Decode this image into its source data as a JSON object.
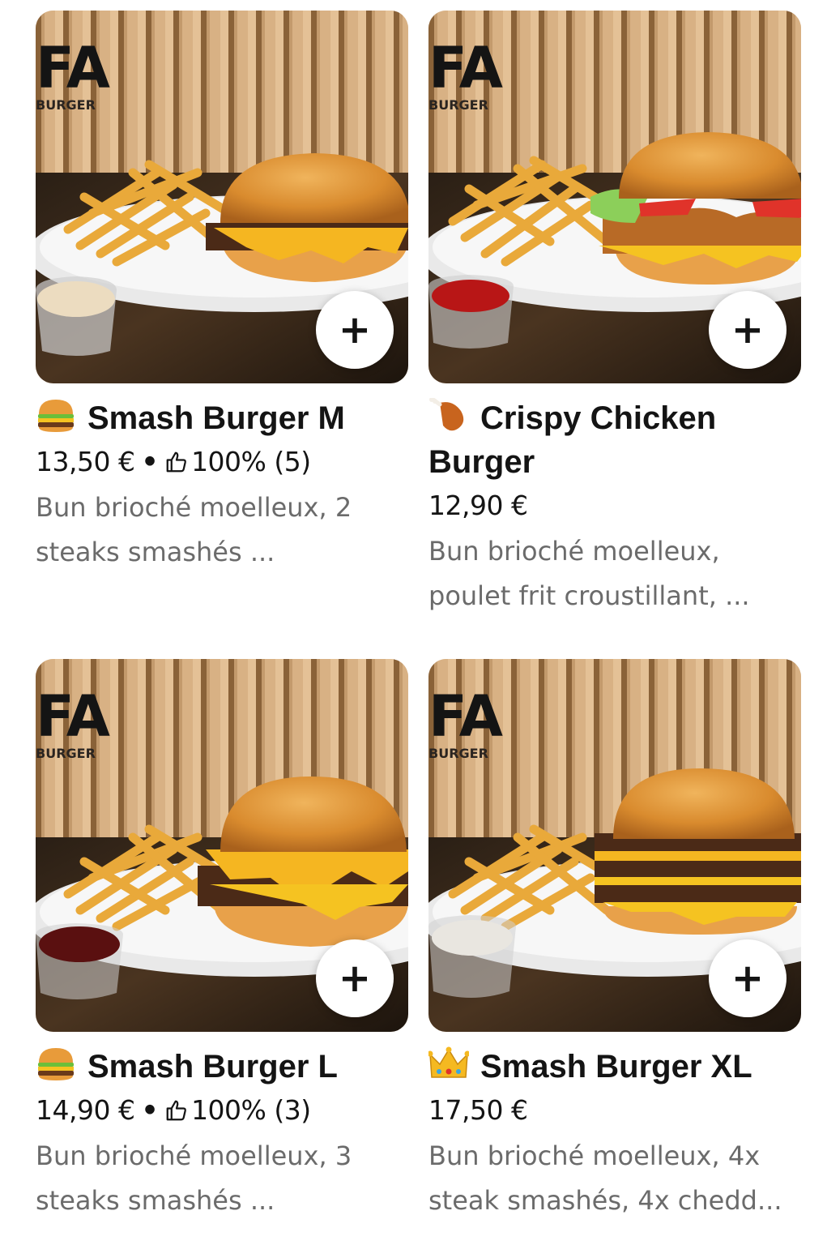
{
  "brand": {
    "main": "FA",
    "sub": "BURGER"
  },
  "add_label": "+",
  "items": [
    {
      "emoji": "burger-emoji",
      "name": "Smash Burger M",
      "price": "13,50 €",
      "rating": "100% (5)",
      "description_line1": "Bun brioché moelleux, 2",
      "description_line2": "steaks smashés ...",
      "sauce_color": "#ecdcc0"
    },
    {
      "emoji": "chicken-leg-emoji",
      "name": "Crispy Chicken Burger",
      "price": "12,90 €",
      "rating": "",
      "description_line1": "Bun brioché moelleux,",
      "description_line2": "poulet frit croustillant, ...",
      "sauce_color": "#b81616"
    },
    {
      "emoji": "burger-emoji",
      "name": "Smash Burger L",
      "price": "14,90 €",
      "rating": "100% (3)",
      "description_line1": "Bun brioché moelleux, 3",
      "description_line2": "steaks smashés ...",
      "sauce_color": "#5a1010"
    },
    {
      "emoji": "crown-emoji",
      "name": "Smash Burger XL",
      "price": "17,50 €",
      "rating": "",
      "description_line1": "Bun brioché moelleux, 4x",
      "description_line2": "steak smashés, 4x chedd...",
      "sauce_color": "#e9e6e0"
    }
  ]
}
